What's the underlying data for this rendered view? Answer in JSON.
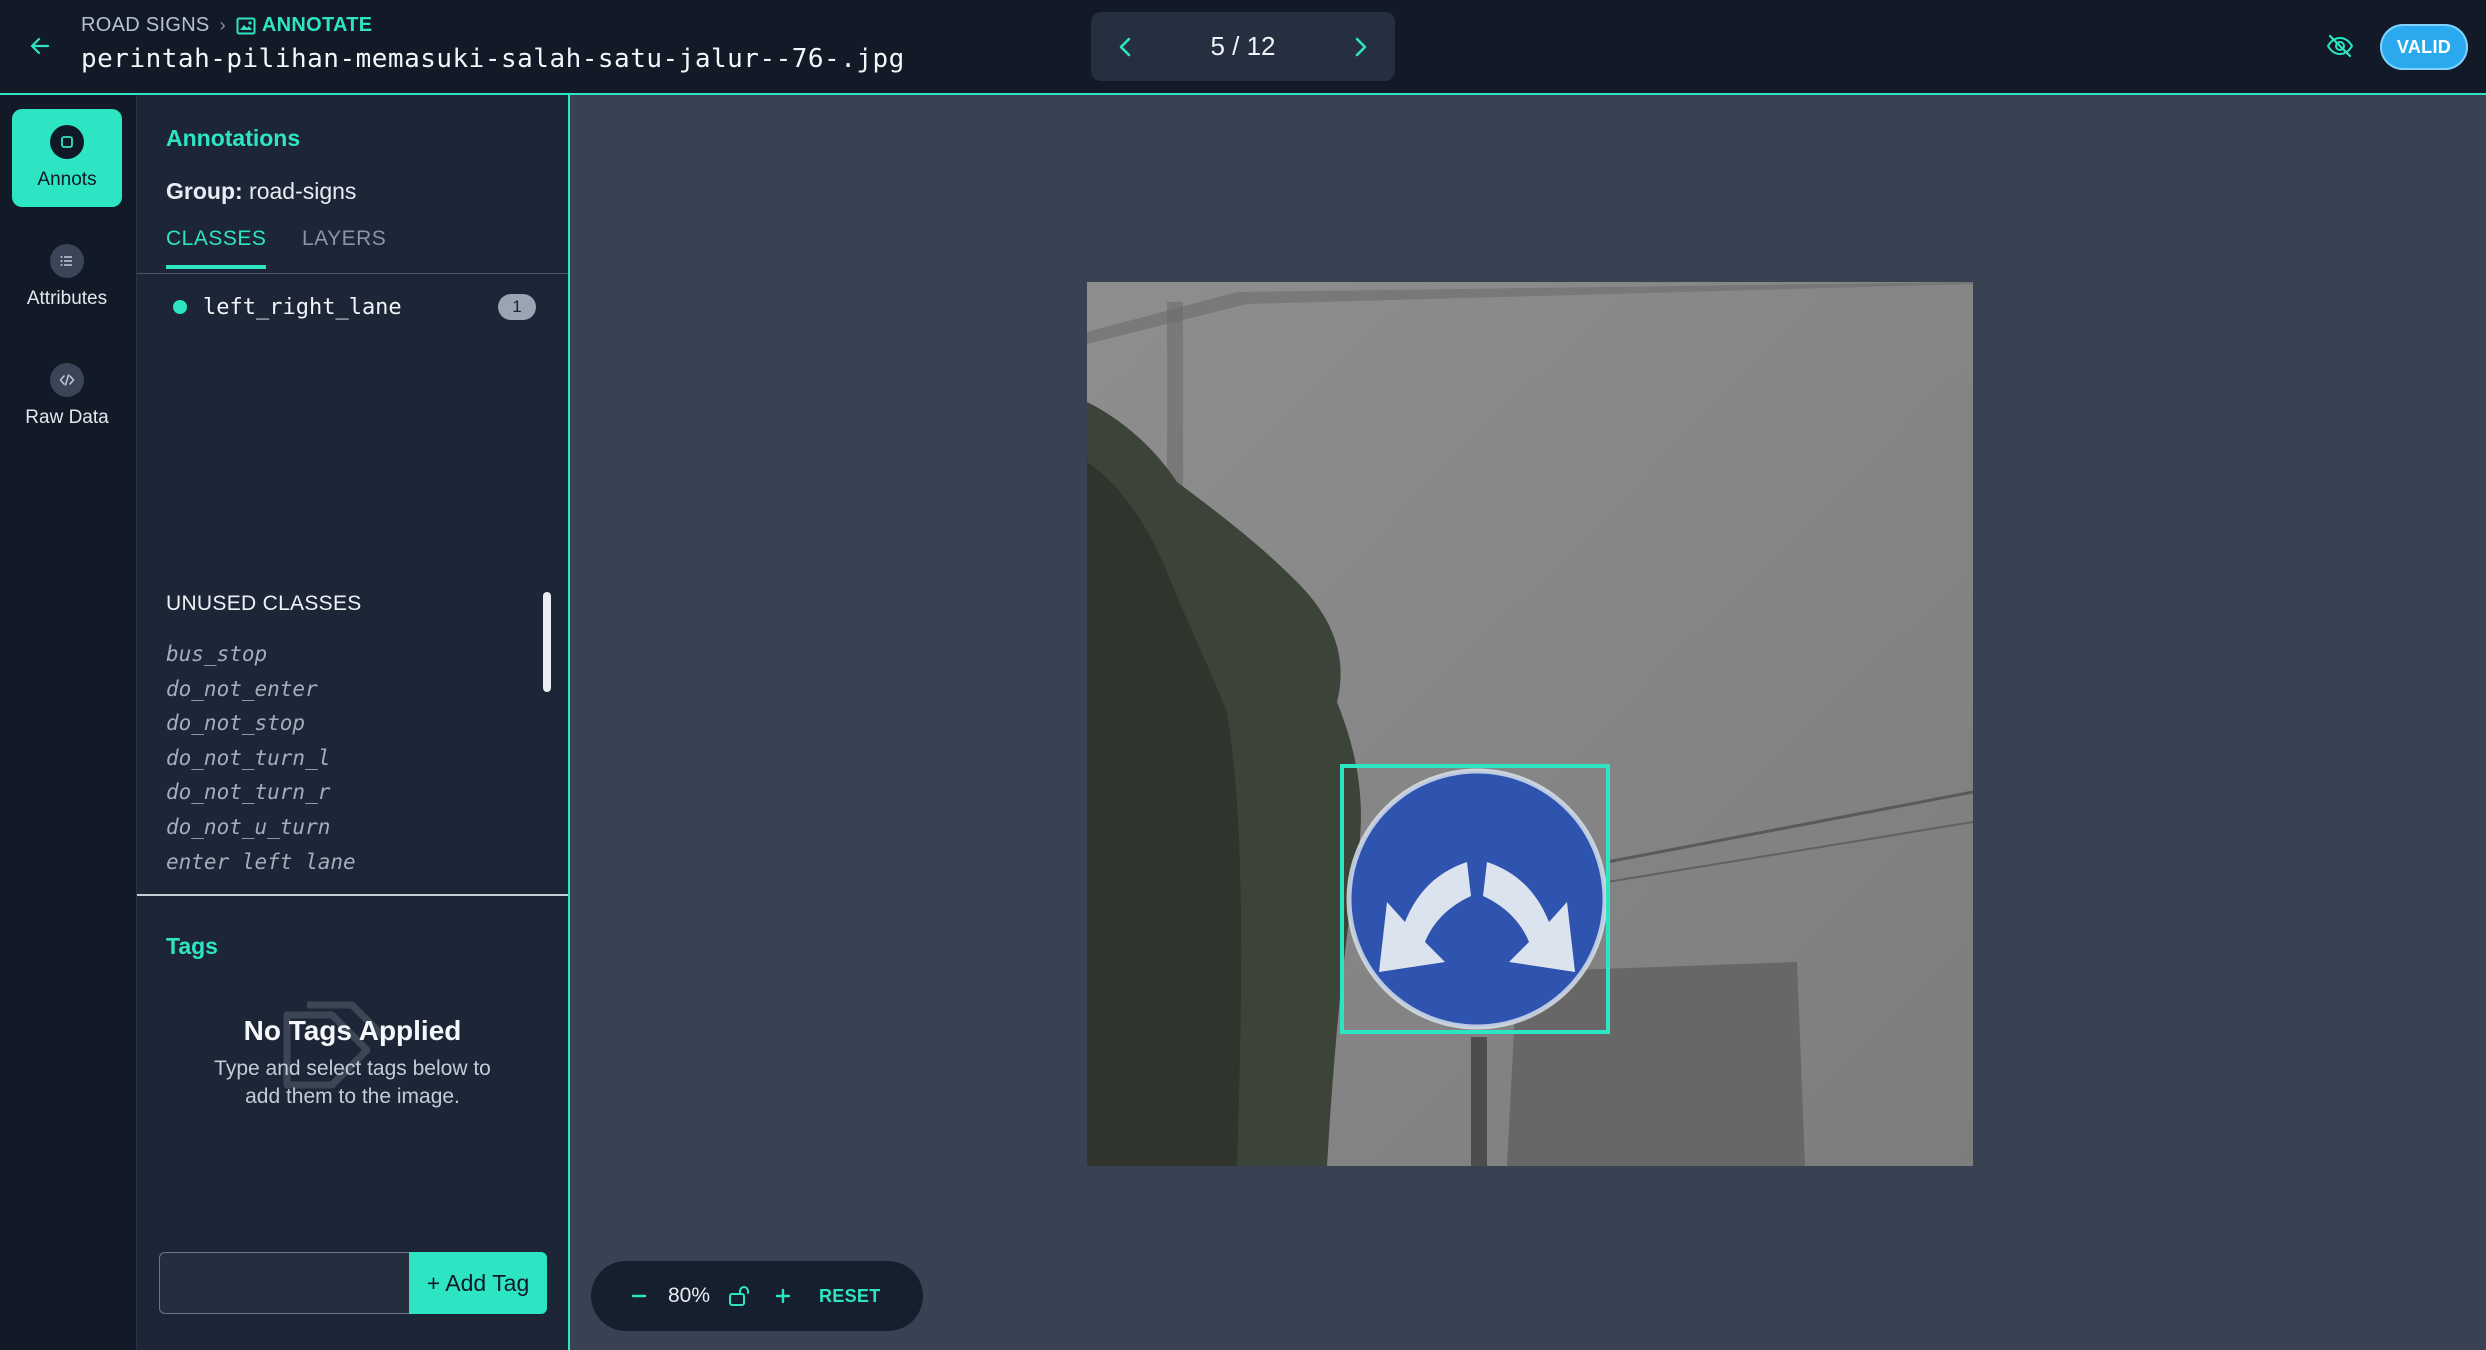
{
  "header": {
    "breadcrumb_root": "ROAD SIGNS",
    "breadcrumb_current": "ANNOTATE",
    "filename": "perintah-pilihan-memasuki-salah-satu-jalur--76-.jpg",
    "pager": "5 / 12",
    "valid_label": "VALID"
  },
  "rail": {
    "annots": "Annots",
    "attributes": "Attributes",
    "raw_data": "Raw Data"
  },
  "panel": {
    "title": "Annotations",
    "group_label": "Group:",
    "group_value": "road-signs",
    "tabs": [
      "CLASSES",
      "LAYERS"
    ],
    "used_classes": [
      {
        "name": "left_right_lane",
        "count": "1",
        "color": "#2ee5c3"
      }
    ],
    "unused_title": "UNUSED CLASSES",
    "unused_classes": [
      "bus_stop",
      "do_not_enter",
      "do_not_stop",
      "do_not_turn_l",
      "do_not_turn_r",
      "do_not_u_turn",
      "enter left lane"
    ]
  },
  "tags": {
    "title": "Tags",
    "empty_title": "No Tags Applied",
    "empty_desc": "Type and select tags below to add them to the image.",
    "input_placeholder": "",
    "add_label": "+ Add Tag"
  },
  "zoom": {
    "level": "80%",
    "reset": "RESET"
  },
  "colors": {
    "accent": "#2ee5c3",
    "valid": "#2aa9ee",
    "sign_blue": "#2f54b0"
  }
}
